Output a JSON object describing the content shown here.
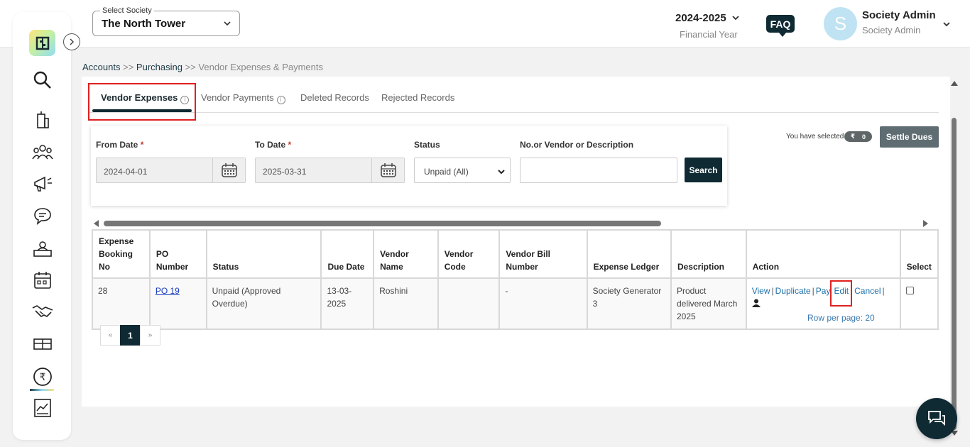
{
  "header": {
    "society_label": "Select Society",
    "society_value": "The North Tower",
    "financial_year": "2024-2025",
    "financial_year_label": "Financial Year",
    "faq": "FAQ",
    "avatar_initial": "S",
    "user_name": "Society Admin",
    "user_role": "Society Admin"
  },
  "sidebar": {
    "items": [
      "logo-icon",
      "search-icon",
      "building-icon",
      "people-icon",
      "megaphone-icon",
      "chat-icon",
      "helpdesk-icon",
      "calendar-icon",
      "handshake-icon",
      "amenities-icon",
      "rupee-icon",
      "reports-icon"
    ]
  },
  "breadcrumb": {
    "items": [
      "Accounts",
      ">>",
      "Purchasing",
      ">>",
      "Vendor Expenses & Payments"
    ]
  },
  "tabs": [
    {
      "label": "Vendor Expenses",
      "active": true,
      "info": "i"
    },
    {
      "label": "Vendor Payments",
      "active": false,
      "info": "i"
    },
    {
      "label": "Deleted Records",
      "active": false
    },
    {
      "label": "Rejected Records",
      "active": false
    }
  ],
  "filters": {
    "from_date_label": "From Date",
    "to_date_label": "To Date",
    "required_mark": "*",
    "status_label": "Status",
    "search_label": "No.or Vendor or Description",
    "from_date": "2024-04-01",
    "to_date": "2025-03-31",
    "status_value": "Unpaid (All)",
    "search_value": "",
    "search_button": "Search"
  },
  "selection": {
    "text": "You have selected",
    "currency": "₹",
    "count": "0",
    "settle_button": "Settle Dues"
  },
  "table": {
    "headers": [
      "Expense Booking No",
      "PO Number",
      "Status",
      "Due Date",
      "Vendor Name",
      "Vendor Code",
      "Vendor Bill Number",
      "Expense Ledger",
      "Description",
      "Action",
      "Select"
    ],
    "rows": [
      {
        "booking_no": "28",
        "po_number": "PO 19",
        "status": "Unpaid (Approved Overdue)",
        "due_date": "13-03-2025",
        "vendor_name": "Roshini",
        "vendor_code": "",
        "vendor_bill_number": "-",
        "expense_ledger": "Society Generator 3",
        "description": "Product delivered March 2025",
        "actions": {
          "view": "View",
          "duplicate": "Duplicate",
          "pay": "Pay",
          "edit": "Edit",
          "cancel": "Cancel",
          "sep": "|"
        }
      }
    ]
  },
  "pagination": {
    "prev": "«",
    "current": "1",
    "next": "»",
    "rows_per_page": "Row per page: 20"
  },
  "colors": {
    "primary_dark": "#0f2a33",
    "highlight": "#e02020",
    "link": "#1a6fa8"
  }
}
